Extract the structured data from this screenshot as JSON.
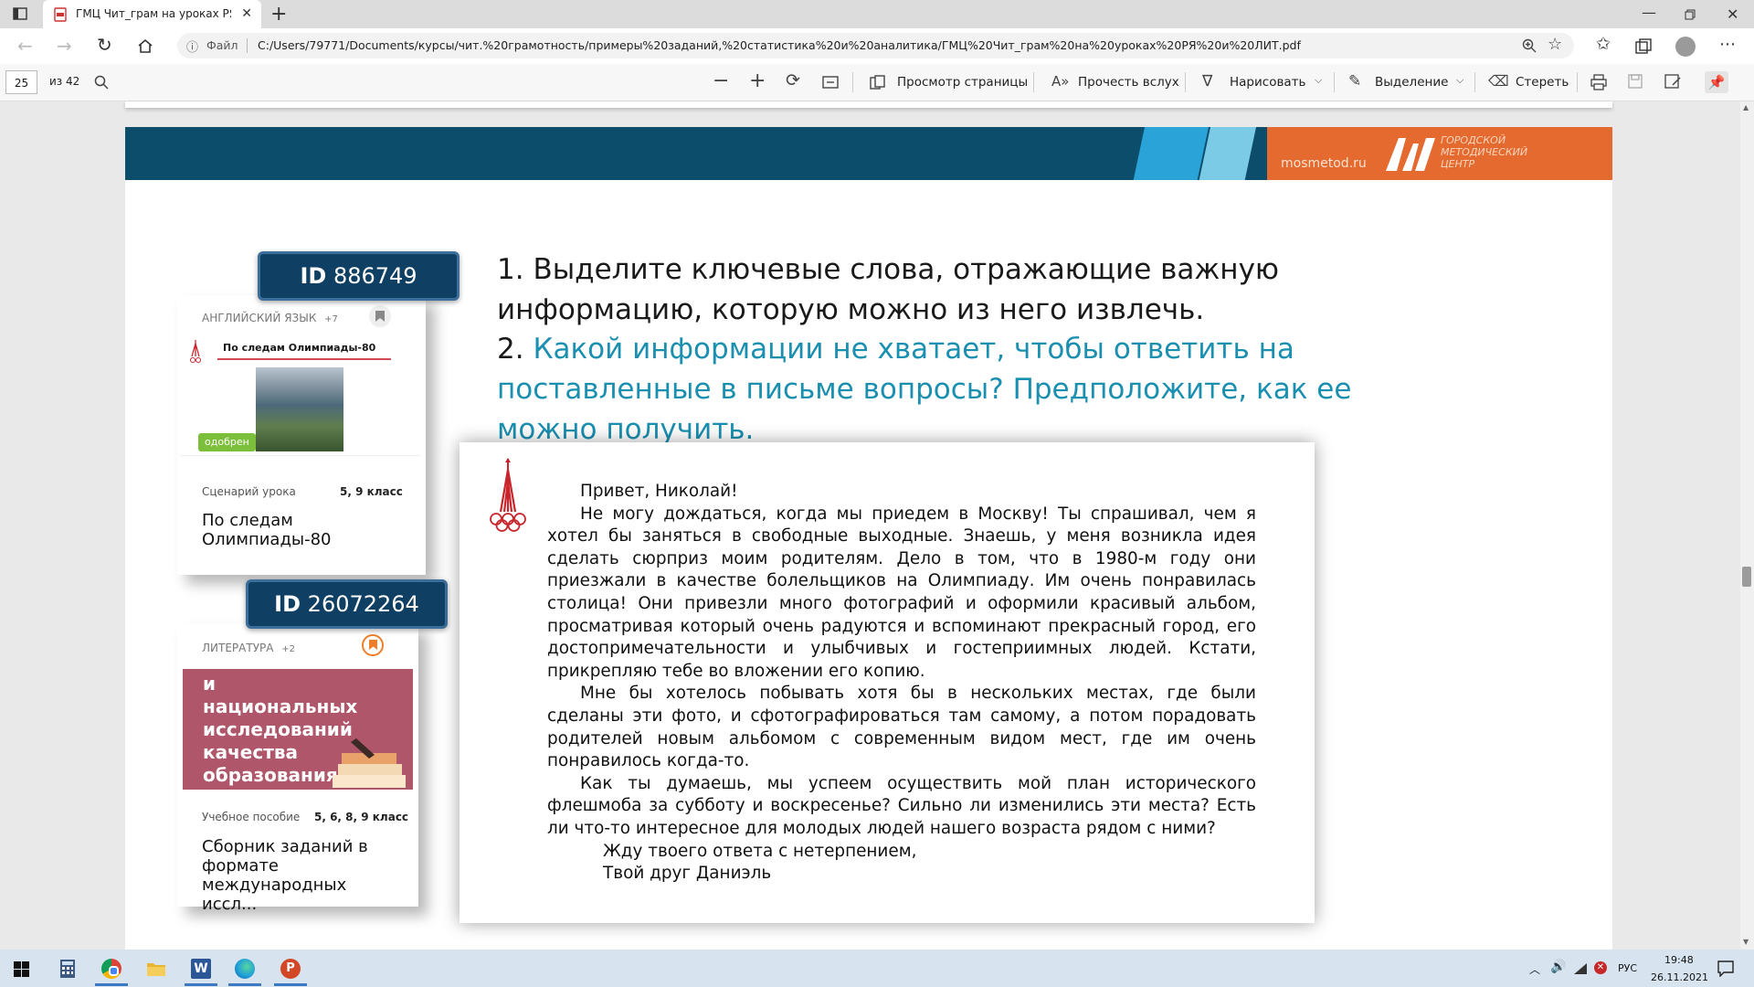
{
  "browser": {
    "tab_title": "ГМЦ Чит_грам на уроках РЯ и Л",
    "url_scheme_label": "Файл",
    "url": "C:/Users/79771/Documents/курсы/чит.%20грамотность/примеры%20заданий,%20статистика%20и%20аналитика/ГМЦ%20Чит_грам%20на%20уроках%20РЯ%20и%20ЛИТ.pdf"
  },
  "pdf_toolbar": {
    "page_number": "25",
    "page_total": "из 42",
    "page_view": "Просмотр страницы",
    "read_aloud": "Прочесть вслух",
    "draw": "Нарисовать",
    "highlight": "Выделение",
    "erase": "Стереть"
  },
  "banner": {
    "site": "mosmetod.ru",
    "org_line1": "ГОРОДСКОЙ",
    "org_line2": "МЕТОДИЧЕСКИЙ",
    "org_line3": "ЦЕНТР"
  },
  "card1": {
    "id_prefix": "ID",
    "id_value": "886749",
    "subject": "АНГЛИЙСКИЙ ЯЗЫК",
    "subject_extra": "+7",
    "thumb_title": "По следам Олимпиады-80",
    "badge": "одобрен",
    "type": "Сценарий урока",
    "grades": "5, 9 класс",
    "title": "По следам Олимпиады-80"
  },
  "card2": {
    "id_prefix": "ID",
    "id_value": "26072264",
    "subject": "ЛИТЕРАТУРА",
    "subject_extra": "+2",
    "cover_text": "и национальных исследований качества образования",
    "type": "Учебное пособие",
    "grades": "5, 6, 8, 9 класс",
    "title": "Сборник заданий в формате международных иссл..."
  },
  "tasks": {
    "t1_num": "1.",
    "t1_text": "Выделите ключевые слова, отражающие важную информацию, которую можно из него извлечь.",
    "t2_num": "2.",
    "t2_text": "Какой информации не хватает, чтобы ответить на поставленные в письме вопросы? Предположите, как ее можно получить."
  },
  "letter": {
    "greeting": "Привет, Николай!",
    "p1": "Не могу дождаться, когда мы приедем в Москву! Ты спрашивал, чем я хотел бы заняться в свободные выходные. Знаешь, у меня возникла идея сделать сюрприз моим родителям. Дело в том, что в 1980-м году они приезжали в качестве болельщиков на Олимпиаду. Им очень понравилась столица! Они привезли много фотографий и оформили красивый альбом, просматривая который очень радуются и вспоминают прекрасный город, его достопримечательности и улыбчивых и гостеприимных людей. Кстати, прикрепляю тебе во вложении его копию.",
    "p2": "Мне бы хотелось побывать хотя бы в нескольких местах, где были сделаны эти фото, и сфотографироваться там самому, а потом порадовать родителей новым альбомом с современным видом мест, где им очень понравилось когда-то.",
    "p3": "Как ты думаешь, мы успеем осуществить мой план исторического флешмоба за субботу и воскресенье? Сильно ли изменились эти места? Есть ли что-то интересное для молодых людей нашего возраста рядом с ними?",
    "closing": "Жду твоего ответа с нетерпением,",
    "signature": "Твой друг Даниэль"
  },
  "taskbar": {
    "lang": "РУС",
    "time": "19:48",
    "date": "26.11.2021"
  },
  "colors": {
    "banner_navy": "#0b4d6b",
    "banner_orange": "#e46a2f",
    "task_highlight": "#1a8fb0",
    "id_badge": "#0f3f63",
    "approved_badge": "#7cbf3a",
    "olympic_red": "#c8262c"
  }
}
